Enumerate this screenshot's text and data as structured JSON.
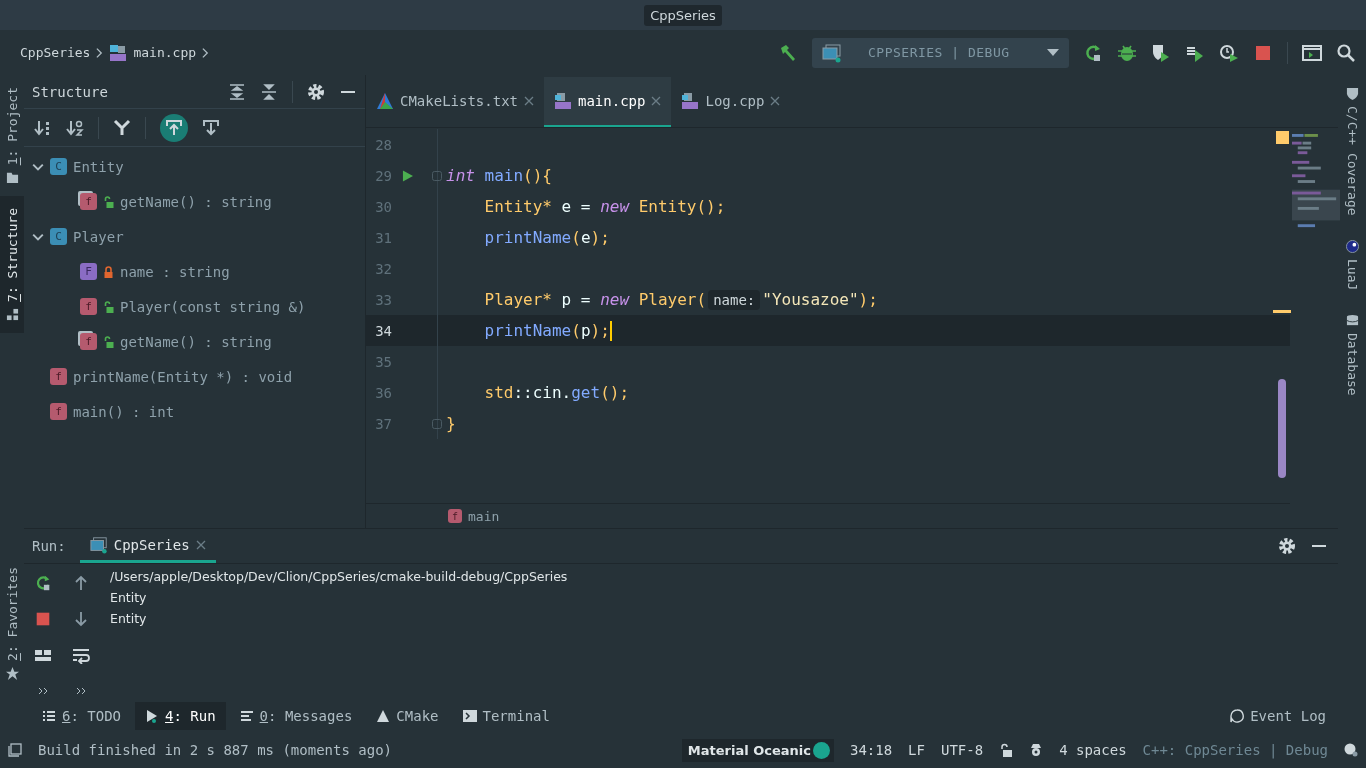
{
  "title_bar": {
    "title": "CppSeries"
  },
  "breadcrumbs": [
    {
      "label": "CppSeries",
      "kind": "folder"
    },
    {
      "label": "main.cpp",
      "kind": "cpp"
    }
  ],
  "run_config": {
    "label": "CPPSERIES | DEBUG"
  },
  "left_stripe": [
    {
      "label": "1: Project",
      "kind": "project",
      "selected": false
    },
    {
      "label": "7: Structure",
      "kind": "structure",
      "selected": true
    }
  ],
  "favorites": {
    "label": "2: Favorites"
  },
  "structure": {
    "title": "Structure",
    "tree": [
      {
        "kind": "class",
        "badge": "C",
        "label": "Entity",
        "expanded": true,
        "children": [
          {
            "kind": "method",
            "badge": "f",
            "locked": false,
            "overrides": true,
            "label": "getName() : string"
          }
        ]
      },
      {
        "kind": "class",
        "badge": "C",
        "label": "Player",
        "expanded": true,
        "children": [
          {
            "kind": "field",
            "badge": "F",
            "locked": true,
            "overrides": false,
            "label": "name : string"
          },
          {
            "kind": "method",
            "badge": "f",
            "locked": false,
            "overrides": false,
            "label": "Player(const string &)"
          },
          {
            "kind": "method",
            "badge": "f",
            "locked": false,
            "overrides": true,
            "label": "getName() : string"
          }
        ]
      },
      {
        "kind": "method",
        "badge": "f",
        "overrides": false,
        "label": "printName(Entity *) : void"
      },
      {
        "kind": "method",
        "badge": "f",
        "overrides": false,
        "label": "main() : int"
      }
    ]
  },
  "editor": {
    "tabs": [
      {
        "label": "CMakeLists.txt",
        "kind": "cmake",
        "selected": false
      },
      {
        "label": "main.cpp",
        "kind": "cpp",
        "selected": true
      },
      {
        "label": "Log.cpp",
        "kind": "cpp",
        "selected": false
      }
    ],
    "lines": [
      {
        "number": "28",
        "current": false,
        "run": false,
        "fold": false
      },
      {
        "number": "29",
        "current": false,
        "run": true,
        "fold": true,
        "tokens": [
          {
            "text": "int",
            "kind": "keyword"
          },
          {
            "text": " main",
            "kind": "function"
          },
          {
            "text": "(){",
            "kind": "punct"
          }
        ]
      },
      {
        "number": "30",
        "current": false,
        "run": false,
        "fold": false,
        "tokens": [
          {
            "text": "    Entity*",
            "kind": "type"
          },
          {
            "text": " e = ",
            "kind": "plain"
          },
          {
            "text": "new",
            "kind": "keyword"
          },
          {
            "text": " Entity",
            "kind": "type"
          },
          {
            "text": "();",
            "kind": "punct"
          }
        ]
      },
      {
        "number": "31",
        "current": false,
        "run": false,
        "fold": false,
        "tokens": [
          {
            "text": "    printName",
            "kind": "function"
          },
          {
            "text": "(",
            "kind": "punct"
          },
          {
            "text": "e",
            "kind": "plain"
          },
          {
            "text": ");",
            "kind": "punct"
          }
        ]
      },
      {
        "number": "32",
        "current": false,
        "run": false,
        "fold": false
      },
      {
        "number": "33",
        "current": false,
        "run": false,
        "fold": false,
        "tokens": [
          {
            "text": "    Player*",
            "kind": "type"
          },
          {
            "text": " p = ",
            "kind": "plain"
          },
          {
            "text": "new",
            "kind": "keyword"
          },
          {
            "text": " Player",
            "kind": "type"
          },
          {
            "text": "(",
            "kind": "punct"
          },
          {
            "text": "name:",
            "kind": "hint"
          },
          {
            "text": "\"Yousazoe\"",
            "kind": "string"
          },
          {
            "text": ");",
            "kind": "punct"
          }
        ]
      },
      {
        "number": "34",
        "current": true,
        "run": false,
        "fold": false,
        "tokens": [
          {
            "text": "    printName",
            "kind": "function"
          },
          {
            "text": "(",
            "kind": "punct"
          },
          {
            "text": "p",
            "kind": "plain"
          },
          {
            "text": ");",
            "kind": "punct"
          }
        ]
      },
      {
        "number": "35",
        "current": false,
        "run": false,
        "fold": false
      },
      {
        "number": "36",
        "current": false,
        "run": false,
        "fold": false,
        "tokens": [
          {
            "text": "    std",
            "kind": "type"
          },
          {
            "text": "::cin.",
            "kind": "plain"
          },
          {
            "text": "get",
            "kind": "function"
          },
          {
            "text": "();",
            "kind": "punct"
          }
        ]
      },
      {
        "number": "37",
        "current": false,
        "run": false,
        "fold": true,
        "tokens": [
          {
            "text": "}",
            "kind": "punct"
          }
        ]
      }
    ],
    "breadcrumb": {
      "badge": "f",
      "label": "main"
    }
  },
  "right_stripe": [
    {
      "label": "C/C++ Coverage",
      "kind": "coverage"
    },
    {
      "label": "LuaJ",
      "kind": "lua"
    },
    {
      "label": "Database",
      "kind": "database"
    }
  ],
  "run_panel": {
    "label": "Run:",
    "tabs": [
      {
        "label": "CppSeries",
        "selected": true
      }
    ],
    "output": [
      "/Users/apple/Desktop/Dev/Clion/CppSeries/cmake-build-debug/CppSeries",
      "Entity",
      "Entity"
    ]
  },
  "tool_windows": [
    {
      "text": "6: TODO",
      "kind": "todo",
      "selected": false
    },
    {
      "text": "4: Run",
      "kind": "run",
      "selected": true
    },
    {
      "text": "0: Messages",
      "kind": "messages",
      "selected": false
    },
    {
      "text": "CMake",
      "kind": "cmake",
      "selected": false
    },
    {
      "text": "Terminal",
      "kind": "terminal",
      "selected": false
    }
  ],
  "event_log": "Event Log",
  "status_bar": {
    "message": "Build finished in 2 s 887 ms (moments ago)",
    "theme": "Material Oceanic",
    "position": "34:18",
    "line_separator": "LF",
    "encoding": "UTF-8",
    "indent": "4 spaces",
    "context": "C++: CppSeries | Debug"
  }
}
